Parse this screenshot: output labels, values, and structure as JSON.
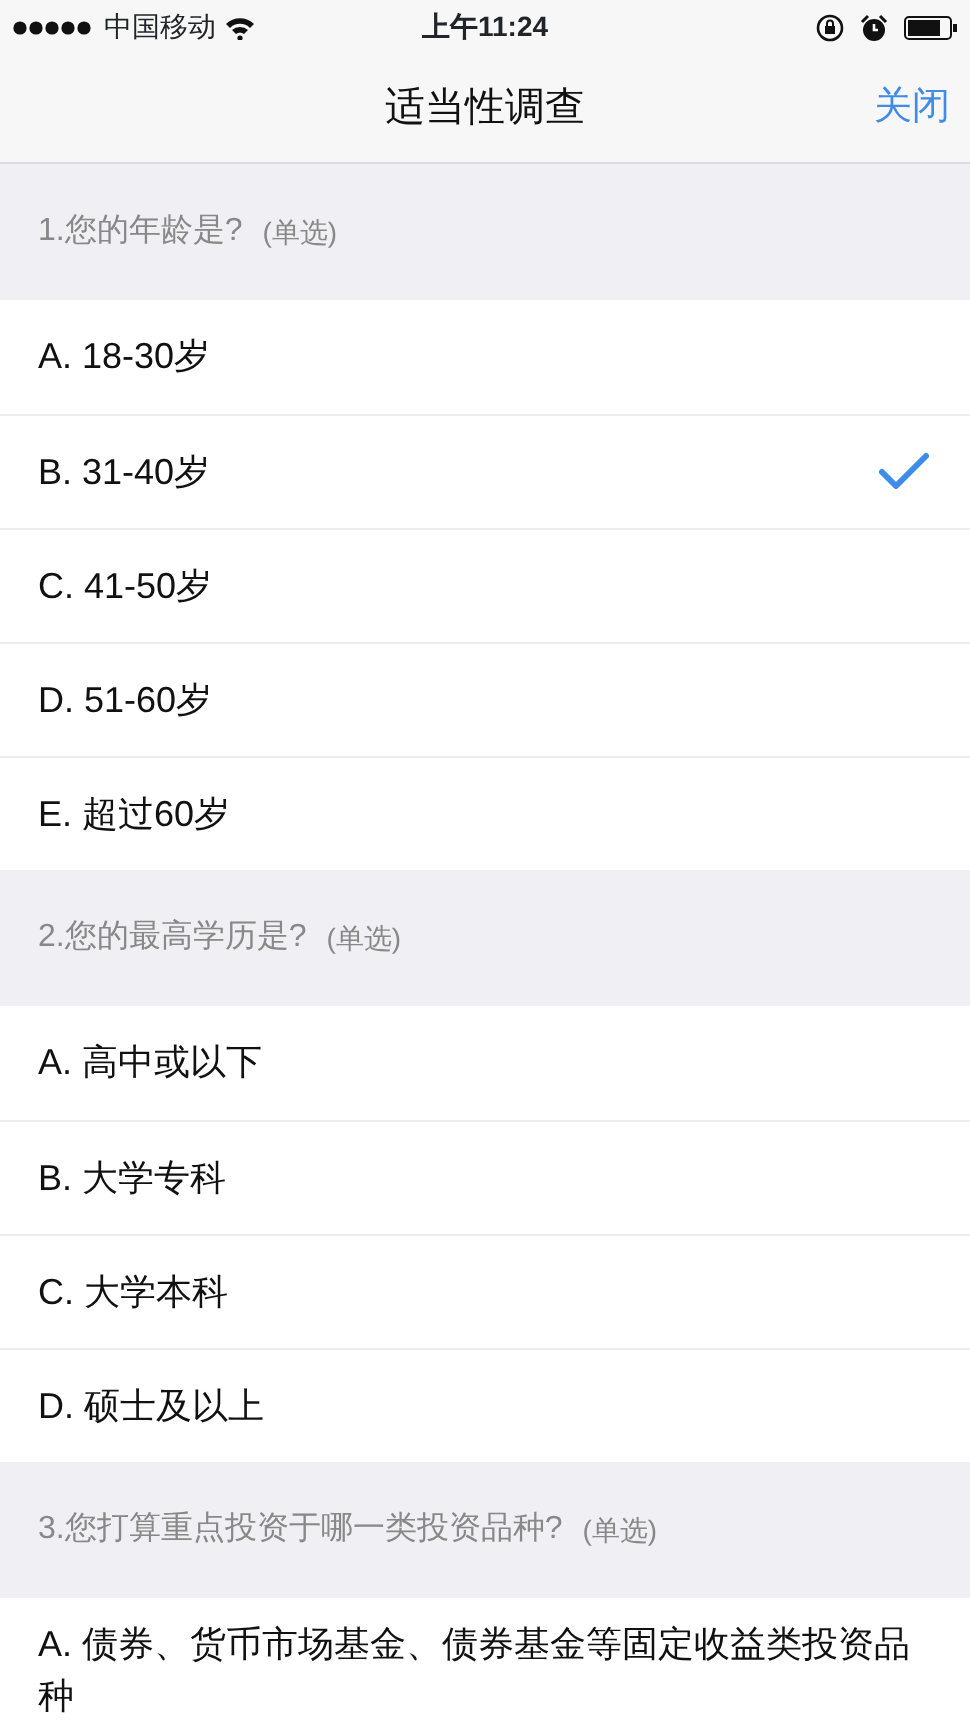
{
  "status_bar": {
    "carrier": "中国移动",
    "time": "上午11:24"
  },
  "nav": {
    "title": "适当性调查",
    "close": "关闭"
  },
  "questions": [
    {
      "title": "1.您的年龄是?",
      "type_label": "(单选)",
      "options": [
        {
          "label": "A. 18-30岁",
          "selected": false
        },
        {
          "label": "B. 31-40岁",
          "selected": true
        },
        {
          "label": "C. 41-50岁",
          "selected": false
        },
        {
          "label": "D. 51-60岁",
          "selected": false
        },
        {
          "label": "E. 超过60岁",
          "selected": false
        }
      ]
    },
    {
      "title": "2.您的最高学历是?",
      "type_label": "(单选)",
      "options": [
        {
          "label": "A. 高中或以下",
          "selected": false
        },
        {
          "label": "B. 大学专科",
          "selected": false
        },
        {
          "label": "C. 大学本科",
          "selected": false
        },
        {
          "label": "D. 硕士及以上",
          "selected": false
        }
      ]
    },
    {
      "title": "3.您打算重点投资于哪一类投资品种?",
      "type_label": "(单选)",
      "options": [
        {
          "label": "A. 债券、货币市场基金、债券基金等固定收益类投资品种",
          "selected": false
        }
      ]
    }
  ]
}
